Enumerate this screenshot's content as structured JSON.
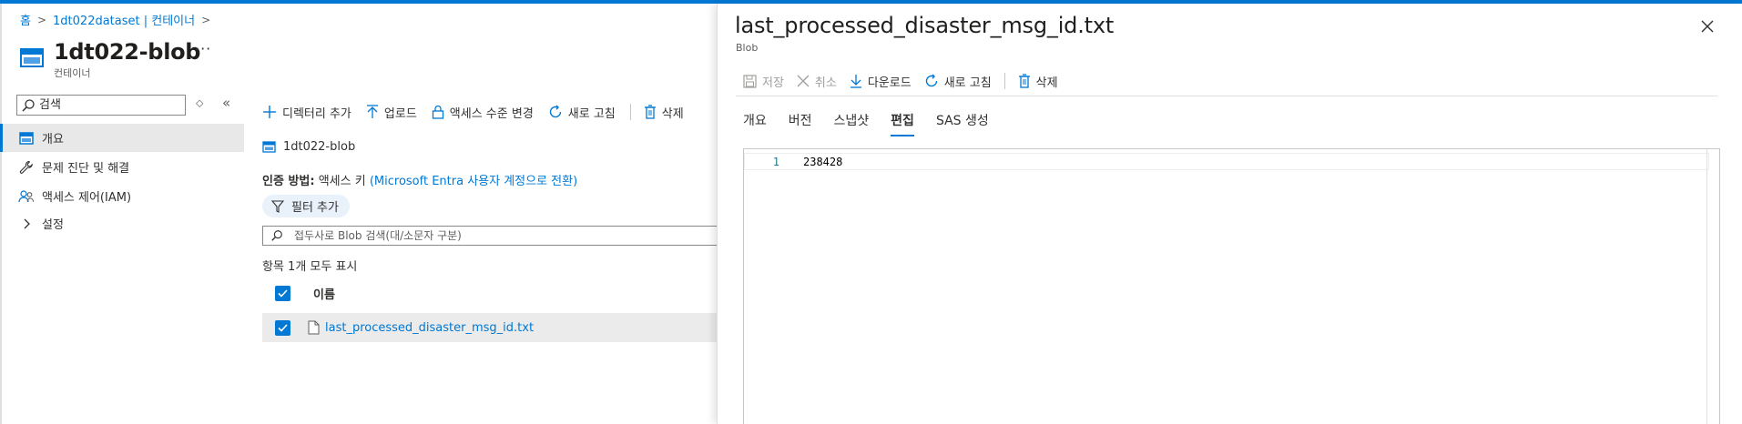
{
  "breadcrumb": {
    "items": [
      "홈",
      "1dt022dataset | 컨테이너"
    ]
  },
  "header": {
    "title": "1dt022-blob",
    "subtitle": "컨테이너",
    "more": "···"
  },
  "nav": {
    "search_placeholder": "검색",
    "items": [
      {
        "label": "개요",
        "icon": "container-icon",
        "active": true
      },
      {
        "label": "문제 진단 및 해결",
        "icon": "wrench-icon"
      },
      {
        "label": "액세스 제어(IAM)",
        "icon": "people-icon"
      },
      {
        "label": "설정",
        "icon": "chevron-right-icon"
      }
    ]
  },
  "toolbar": {
    "add_dir": "디렉터리 추가",
    "upload": "업로드",
    "access_level": "액세스 수준 변경",
    "refresh": "새로 고침",
    "delete": "삭제"
  },
  "main": {
    "path": "1dt022-blob",
    "auth_label": "인증 방법:",
    "auth_value": "액세스 키",
    "auth_link": "(Microsoft Entra 사용자 계정으로 전환)",
    "filter_add": "필터 추가",
    "blob_search_placeholder": "접두사로 Blob 검색(대/소문자 구분)",
    "count_text": "항목 1개 모두 표시",
    "column_name": "이름",
    "rows": [
      {
        "name": "last_processed_disaster_msg_id.txt",
        "checked": true
      }
    ]
  },
  "blade": {
    "title": "last_processed_disaster_msg_id.txt",
    "subtitle": "Blob",
    "toolbar": {
      "save": "저장",
      "cancel": "취소",
      "download": "다운로드",
      "refresh": "새로 고침",
      "delete": "삭제"
    },
    "tabs": [
      "개요",
      "버전",
      "스냅샷",
      "편집",
      "SAS 생성"
    ],
    "active_tab": "편집",
    "editor": {
      "line_number": "1",
      "content": "238428"
    }
  },
  "colors": {
    "accent": "#0078d4",
    "nav_active_bg": "#e8e8e8",
    "row_selected_bg": "#ebebeb"
  }
}
